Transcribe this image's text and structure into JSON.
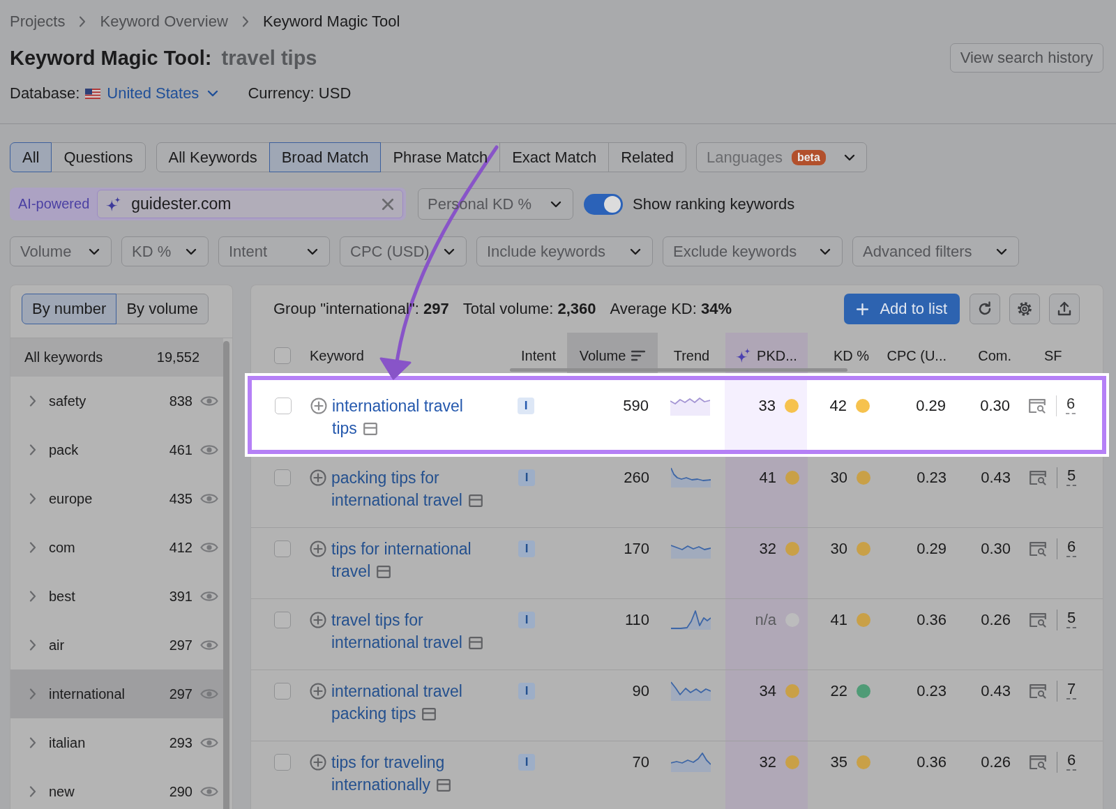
{
  "breadcrumbs": [
    {
      "label": "Projects"
    },
    {
      "label": "Keyword Overview"
    },
    {
      "label": "Keyword Magic Tool"
    }
  ],
  "header": {
    "title": "Keyword Magic Tool:",
    "query": "travel tips",
    "history_button": "View search history",
    "database_label": "Database:",
    "database_value": "United States",
    "currency": "Currency: USD"
  },
  "scope_tabs": [
    {
      "label": "All",
      "selected": true
    },
    {
      "label": "Questions",
      "selected": false
    }
  ],
  "match_tabs": [
    {
      "label": "All Keywords",
      "selected": false
    },
    {
      "label": "Broad Match",
      "selected": true
    },
    {
      "label": "Phrase Match",
      "selected": false
    },
    {
      "label": "Exact Match",
      "selected": false
    },
    {
      "label": "Related",
      "selected": false
    }
  ],
  "languages": {
    "label": "Languages",
    "badge": "beta"
  },
  "ai_search": {
    "badge": "AI-powered",
    "value": "guidester.com"
  },
  "personal_kd": {
    "label": "Personal KD %"
  },
  "ranking_toggle": {
    "label": "Show ranking keywords",
    "on": true
  },
  "filters": [
    {
      "label": "Volume"
    },
    {
      "label": "KD %"
    },
    {
      "label": "Intent"
    },
    {
      "label": "CPC (USD)"
    },
    {
      "label": "Include keywords"
    },
    {
      "label": "Exclude keywords"
    },
    {
      "label": "Advanced filters"
    }
  ],
  "group_tabs": [
    {
      "label": "By number",
      "selected": true
    },
    {
      "label": "By volume",
      "selected": false
    }
  ],
  "groups": {
    "all_label": "All keywords",
    "all_count": "19,552",
    "items": [
      {
        "label": "safety",
        "count": "838",
        "selected": false
      },
      {
        "label": "pack",
        "count": "461",
        "selected": false
      },
      {
        "label": "europe",
        "count": "435",
        "selected": false
      },
      {
        "label": "com",
        "count": "412",
        "selected": false
      },
      {
        "label": "best",
        "count": "391",
        "selected": false
      },
      {
        "label": "air",
        "count": "297",
        "selected": false
      },
      {
        "label": "international",
        "count": "297",
        "selected": true
      },
      {
        "label": "italian",
        "count": "293",
        "selected": false
      },
      {
        "label": "new",
        "count": "290",
        "selected": false
      }
    ]
  },
  "summary": [
    "Group \"international\": **297**",
    "Total volume: **2,360**",
    "Average KD: **34%**"
  ],
  "add_button": "Add to list",
  "table": {
    "all_checked": false,
    "columns": [
      {
        "label": "Keyword",
        "kind": "keyword",
        "sorted": false
      },
      {
        "label": "Intent",
        "kind": "intent",
        "sorted": false
      },
      {
        "label": "Volume",
        "kind": "volume",
        "sorted": true
      },
      {
        "label": "Trend",
        "kind": "trend",
        "sorted": false
      },
      {
        "label": "PKD...",
        "kind": "pkd",
        "sorted": false
      },
      {
        "label": "KD %",
        "kind": "kd",
        "sorted": false
      },
      {
        "label": "CPC (U...",
        "kind": "cpc",
        "sorted": false
      },
      {
        "label": "Com.",
        "kind": "com",
        "sorted": false
      },
      {
        "label": "SF",
        "kind": "sf",
        "sorted": false
      }
    ],
    "rows": [
      {
        "keyword": "international travel tips",
        "intent": "I",
        "volume": "590",
        "pkd": {
          "value": "33",
          "missing": false,
          "color": "#f6c24e"
        },
        "kd": {
          "value": "42",
          "color": "#f6c24e"
        },
        "cpc": "0.29",
        "com": "0.30",
        "sf": "6",
        "checked": false,
        "highlighted": true
      },
      {
        "keyword": "packing tips for international travel",
        "intent": "I",
        "volume": "260",
        "pkd": {
          "value": "41",
          "missing": false,
          "color": "#c9a047"
        },
        "kd": {
          "value": "30",
          "color": "#c9a047"
        },
        "cpc": "0.23",
        "com": "0.43",
        "sf": "5",
        "checked": false,
        "highlighted": false
      },
      {
        "keyword": "tips for international travel",
        "intent": "I",
        "volume": "170",
        "pkd": {
          "value": "32",
          "missing": false,
          "color": "#c9a047"
        },
        "kd": {
          "value": "30",
          "color": "#c9a047"
        },
        "cpc": "0.29",
        "com": "0.30",
        "sf": "6",
        "checked": false,
        "highlighted": false
      },
      {
        "keyword": "travel tips for international travel",
        "intent": "I",
        "volume": "110",
        "pkd": {
          "value": "n/a",
          "missing": true,
          "color": "#bcbcbd"
        },
        "kd": {
          "value": "41",
          "color": "#c9a047"
        },
        "cpc": "0.36",
        "com": "0.26",
        "sf": "5",
        "checked": false,
        "highlighted": false
      },
      {
        "keyword": "international travel packing tips",
        "intent": "I",
        "volume": "90",
        "pkd": {
          "value": "34",
          "missing": false,
          "color": "#c9a047"
        },
        "kd": {
          "value": "22",
          "color": "#4f9b76"
        },
        "cpc": "0.23",
        "com": "0.43",
        "sf": "7",
        "checked": false,
        "highlighted": false
      },
      {
        "keyword": "tips for traveling internationally",
        "intent": "I",
        "volume": "70",
        "pkd": {
          "value": "32",
          "missing": false,
          "color": "#c9a047"
        },
        "kd": {
          "value": "35",
          "color": "#c9a047"
        },
        "cpc": "0.36",
        "com": "0.26",
        "sf": "6",
        "checked": false,
        "highlighted": false
      }
    ]
  }
}
